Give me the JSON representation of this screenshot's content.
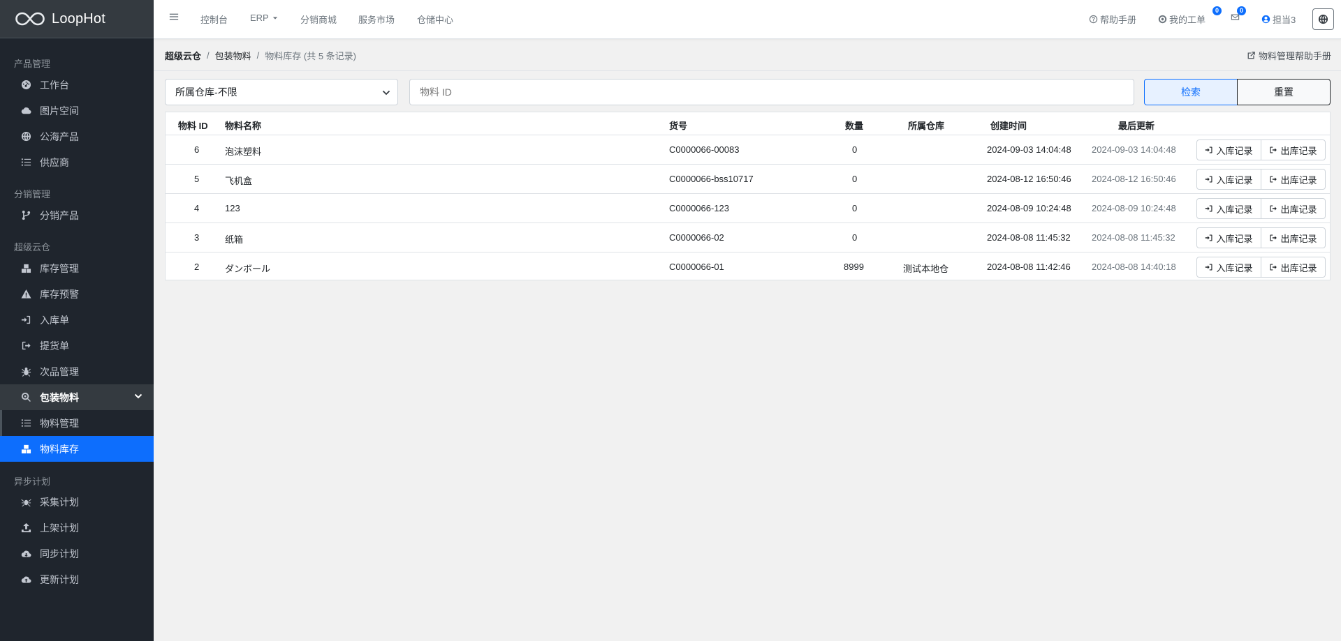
{
  "brand": {
    "name": "LoopHot"
  },
  "sidebar": {
    "sections": [
      {
        "label": "产品管理"
      },
      {
        "label": "分销管理"
      },
      {
        "label": "超级云仓"
      },
      {
        "label": "异步计划"
      }
    ],
    "items": [
      {
        "label": "工作台",
        "icon": "dashboard-icon"
      },
      {
        "label": "图片空间",
        "icon": "cloud-icon"
      },
      {
        "label": "公海产品",
        "icon": "globe-icon"
      },
      {
        "label": "供应商",
        "icon": "list-icon"
      },
      {
        "label": "分销产品",
        "icon": "branch-icon"
      },
      {
        "label": "库存管理",
        "icon": "boxes-icon"
      },
      {
        "label": "库存预警",
        "icon": "warning-icon"
      },
      {
        "label": "入库单",
        "icon": "sign-in-icon"
      },
      {
        "label": "提货单",
        "icon": "sign-out-icon"
      },
      {
        "label": "次品管理",
        "icon": "bug-icon"
      },
      {
        "label": "包装物料",
        "icon": "search-gear-icon"
      },
      {
        "label": "物料管理",
        "icon": "list-icon"
      },
      {
        "label": "物料库存",
        "icon": "boxes-icon"
      },
      {
        "label": "采集计划",
        "icon": "spider-icon"
      },
      {
        "label": "上架计划",
        "icon": "upload-icon"
      },
      {
        "label": "同步计划",
        "icon": "cloud-download-icon"
      },
      {
        "label": "更新计划",
        "icon": "cloud-upload-icon"
      }
    ]
  },
  "topnav": {
    "links": [
      "控制台",
      "ERP",
      "分销商城",
      "服务市场",
      "仓储中心"
    ],
    "help": "帮助手册",
    "tickets": "我的工单",
    "tickets_count": "0",
    "messages_count": "0",
    "user": "担当3"
  },
  "breadcrumb": {
    "root": "超级云仓",
    "parent": "包装物料",
    "current": "物料库存 (共 5 条记录)"
  },
  "help_link": "物料管理帮助手册",
  "filters": {
    "warehouse_selected": "所属仓库-不限",
    "material_id_placeholder": "物料 ID",
    "search_label": "检索",
    "reset_label": "重置"
  },
  "table": {
    "headers": [
      "物料 ID",
      "物料名称",
      "货号",
      "数量",
      "所属仓库",
      "创建时间",
      "最后更新"
    ],
    "in_label": "入库记录",
    "out_label": "出库记录",
    "rows": [
      {
        "id": "6",
        "name": "泡沫塑料",
        "sku": "C0000066-00083",
        "qty": "0",
        "warehouse": "",
        "created": "2024-09-03 14:04:48",
        "updated": "2024-09-03 14:04:48"
      },
      {
        "id": "5",
        "name": "飞机盒",
        "sku": "C0000066-bss10717",
        "qty": "0",
        "warehouse": "",
        "created": "2024-08-12 16:50:46",
        "updated": "2024-08-12 16:50:46"
      },
      {
        "id": "4",
        "name": "123",
        "sku": "C0000066-123",
        "qty": "0",
        "warehouse": "",
        "created": "2024-08-09 10:24:48",
        "updated": "2024-08-09 10:24:48"
      },
      {
        "id": "3",
        "name": "纸箱",
        "sku": "C0000066-02",
        "qty": "0",
        "warehouse": "",
        "created": "2024-08-08 11:45:32",
        "updated": "2024-08-08 11:45:32"
      },
      {
        "id": "2",
        "name": "ダンボール",
        "sku": "C0000066-01",
        "qty": "8999",
        "warehouse": "测试本地仓",
        "created": "2024-08-08 11:42:46",
        "updated": "2024-08-08 14:40:18"
      }
    ]
  },
  "colors": {
    "sidebar_bg": "#1f252d",
    "accent": "#0d6efd",
    "page_bg": "#f1f1f1"
  }
}
